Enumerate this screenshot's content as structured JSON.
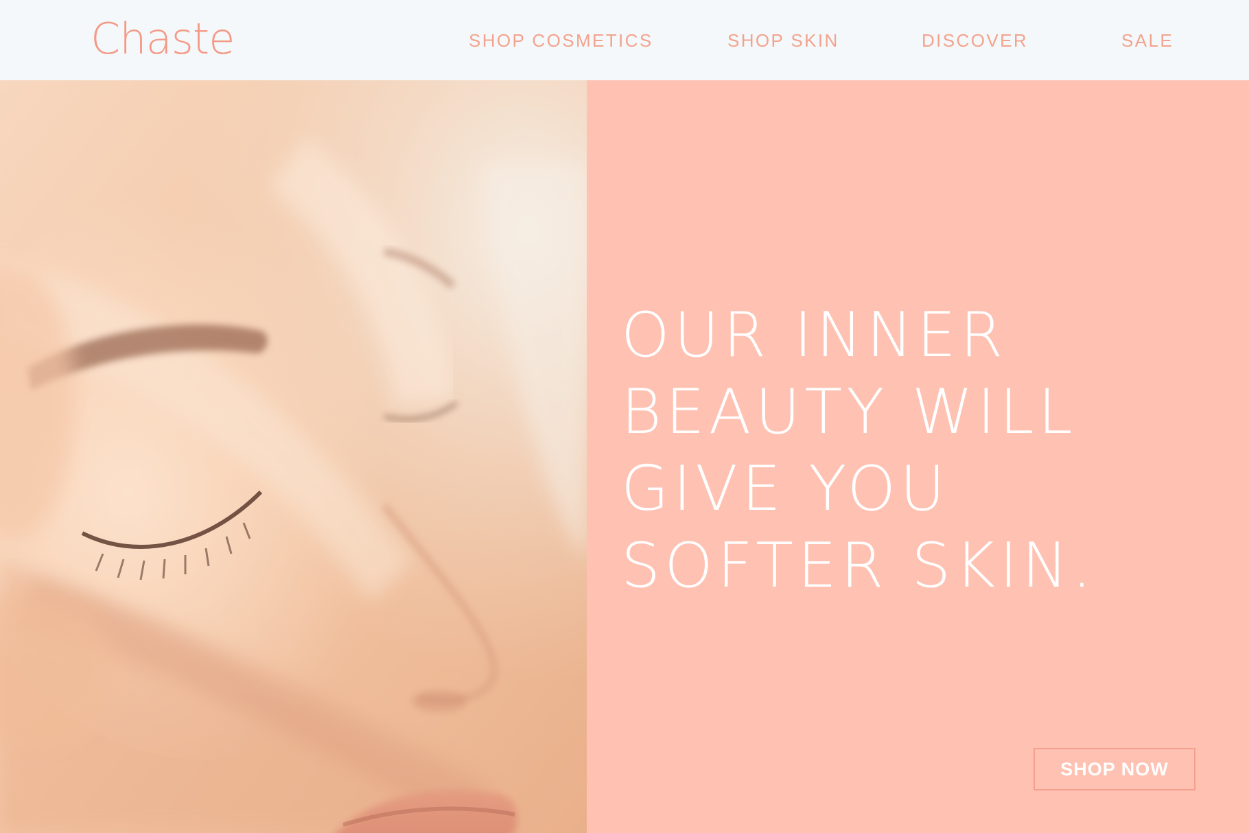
{
  "brand": {
    "logo_text": "Chaste",
    "accent_color": "#f39a86"
  },
  "nav": {
    "items": [
      {
        "label": "SHOP COSMETICS"
      },
      {
        "label": "SHOP SKIN"
      },
      {
        "label": "DISCOVER"
      },
      {
        "label": "SALE"
      }
    ]
  },
  "hero": {
    "image": {
      "alt": "",
      "description_icon": "portrait-photo"
    },
    "panel_color": "#fec1b2",
    "headline_lines": [
      "OUR INNER",
      "BEAUTY WILL",
      "GIVE YOU",
      "SOFTER SKIN."
    ],
    "cta_label": "SHOP NOW"
  }
}
